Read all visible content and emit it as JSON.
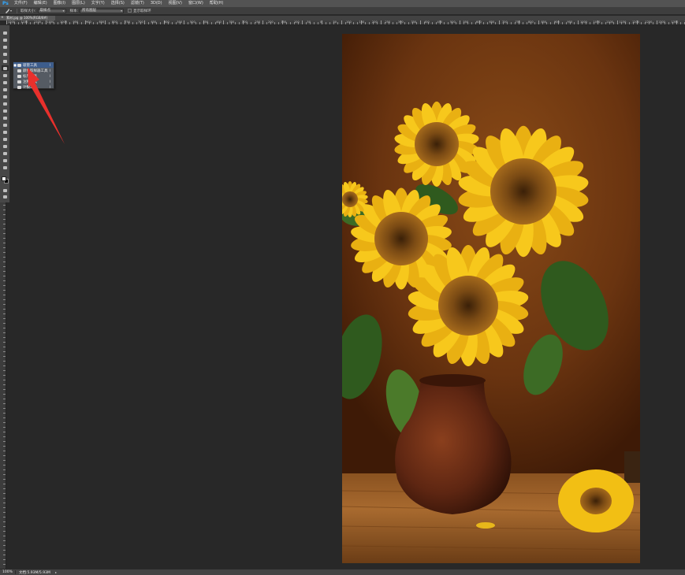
{
  "app": {
    "logo": "Ps"
  },
  "menu": [
    "文件(F)",
    "编辑(E)",
    "图像(I)",
    "图层(L)",
    "文字(Y)",
    "选择(S)",
    "滤镜(T)",
    "3D(D)",
    "视图(V)",
    "窗口(W)",
    "帮助(H)"
  ],
  "options": {
    "sample_size_label": "取样大小:",
    "sample_size_value": "取样点",
    "sample_label": "样本:",
    "sample_value": "所有图层",
    "show_ring_label": "显示取样环"
  },
  "document": {
    "tab_label": "素材.jpg @ 100%(RGB/8#)",
    "close_glyph": "×"
  },
  "ruler_top_labels": [
    "1200",
    "1150",
    "1100",
    "1050",
    "1000",
    "950",
    "900",
    "850",
    "800",
    "750",
    "700",
    "650",
    "600",
    "550",
    "500",
    "450",
    "400",
    "350",
    "300",
    "250",
    "200",
    "150",
    "100",
    "50",
    "0",
    "50",
    "100",
    "150",
    "200",
    "250",
    "300",
    "350",
    "400",
    "450",
    "500",
    "550",
    "600",
    "650",
    "700",
    "750",
    "800",
    "850",
    "900",
    "950",
    "1000",
    "1050",
    "1100",
    "1150",
    "1200",
    "1250",
    "1300",
    "1350",
    "1400"
  ],
  "flyout": {
    "items": [
      {
        "check": "■",
        "label": "吸管工具",
        "key": "I",
        "selected": true,
        "icon": "eyedropper-icon"
      },
      {
        "check": "",
        "label": "颜色取样器工具",
        "key": "I",
        "selected": false,
        "icon": "color-sampler-icon"
      },
      {
        "check": "",
        "label": "标尺工具",
        "key": "I",
        "selected": false,
        "icon": "ruler-icon"
      },
      {
        "check": "",
        "label": "注释工具",
        "key": "I",
        "selected": false,
        "icon": "note-icon"
      },
      {
        "check": "",
        "label": "计数工具",
        "key": "I",
        "selected": false,
        "icon": "count-icon"
      }
    ]
  },
  "tools": [
    "move-tool-icon",
    "marquee-tool-icon",
    "lasso-tool-icon",
    "quick-select-tool-icon",
    "crop-tool-icon",
    "eyedropper-tool-icon",
    "healing-brush-tool-icon",
    "brush-tool-icon",
    "clone-stamp-tool-icon",
    "history-brush-tool-icon",
    "eraser-tool-icon",
    "gradient-tool-icon",
    "blur-tool-icon",
    "dodge-tool-icon",
    "pen-tool-icon",
    "type-tool-icon",
    "path-select-tool-icon",
    "shape-tool-icon",
    "hand-tool-icon",
    "zoom-tool-icon"
  ],
  "colors": {
    "foreground": "#ffffff",
    "background": "#000000",
    "annotation": "#e8302c"
  },
  "status": {
    "zoom": "100%",
    "doc_info": "文档:5.93M/5.93M",
    "arrow": "▸"
  }
}
